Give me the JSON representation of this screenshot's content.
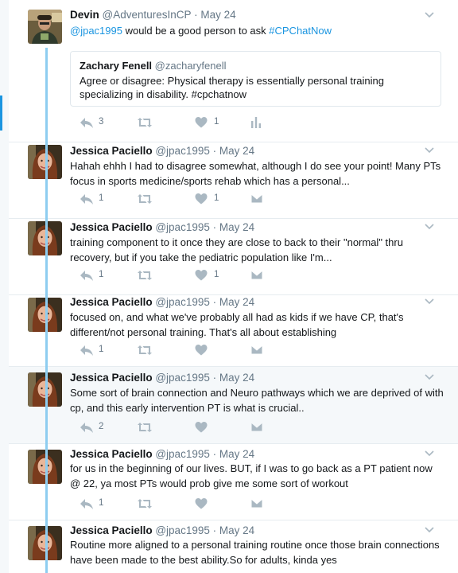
{
  "tweets": [
    {
      "name": "Devin",
      "handle": "@AdventuresInCP",
      "dot": "·",
      "time": "May 24",
      "text_mention": "@jpac1995",
      "text_mid": " would be a good person to ask ",
      "text_hashtag": "#CPChatNow",
      "quote": {
        "name": "Zachary Fenell",
        "handle": "@zacharyfenell",
        "text": "Agree or disagree: Physical therapy is essentially personal training specializing in disability. #cpchatnow"
      },
      "reply_count": "3",
      "retweet_count": "",
      "like_count": "1"
    },
    {
      "name": "Jessica Paciello",
      "handle": "@jpac1995",
      "dot": "·",
      "time": "May 24",
      "text": "Hahah ehhh I had to disagree somewhat, although I do see your point! Many PTs focus in sports medicine/sports rehab which has a personal...",
      "reply_count": "1",
      "retweet_count": "",
      "like_count": "1"
    },
    {
      "name": "Jessica Paciello",
      "handle": "@jpac1995",
      "dot": "·",
      "time": "May 24",
      "text": "training component to it once they are close to back to their \"normal\" thru recovery, but if you take the pediatric population like I'm...",
      "reply_count": "1",
      "retweet_count": "",
      "like_count": "1"
    },
    {
      "name": "Jessica Paciello",
      "handle": "@jpac1995",
      "dot": "·",
      "time": "May 24",
      "text": "focused on, and what we've probably all had as kids if we have CP, that's different/not personal training. That's all about establishing",
      "reply_count": "1",
      "retweet_count": "",
      "like_count": ""
    },
    {
      "name": "Jessica Paciello",
      "handle": "@jpac1995",
      "dot": "·",
      "time": "May 24",
      "text": "Some sort of brain connection and Neuro pathways which we are deprived of with cp, and this early intervention PT is what is crucial..",
      "reply_count": "2",
      "retweet_count": "",
      "like_count": ""
    },
    {
      "name": "Jessica Paciello",
      "handle": "@jpac1995",
      "dot": "·",
      "time": "May 24",
      "text": "for us in the beginning of our lives. BUT, if I was to go back as a PT patient now @ 22, ya most PTs would prob give me some sort of workout",
      "reply_count": "1",
      "retweet_count": "",
      "like_count": ""
    },
    {
      "name": "Jessica Paciello",
      "handle": "@jpac1995",
      "dot": "·",
      "time": "May 24",
      "text": "Routine more aligned to a personal training routine once those brain connections have been made to the best ability.So for adults, kinda yes",
      "reply_count": "",
      "retweet_count": "",
      "like_count": ""
    }
  ],
  "colors": {
    "accent": "#1b95e0",
    "thread_line": "#8ecdf0",
    "muted": "#657786",
    "icon": "#aab8c2"
  },
  "icons": {
    "reply": "reply-icon",
    "retweet": "retweet-icon",
    "like": "heart-icon",
    "analytics": "analytics-icon",
    "dm": "envelope-icon",
    "more": "chevron-down-icon"
  }
}
